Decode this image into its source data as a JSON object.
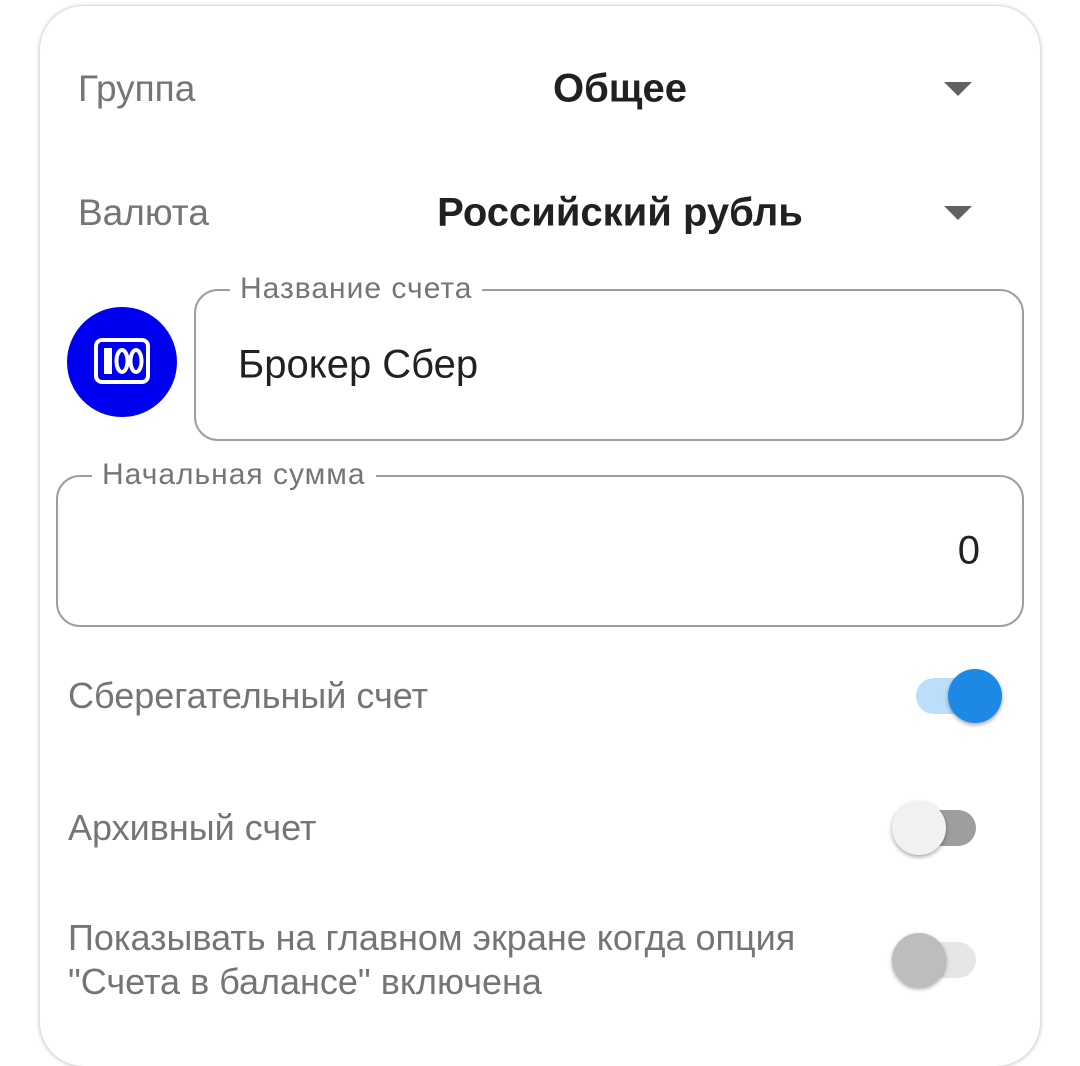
{
  "group": {
    "label": "Группа",
    "value": "Общее"
  },
  "currency": {
    "label": "Валюта",
    "value": "Российский рубль"
  },
  "account_icon": {
    "name": "cash-100-icon",
    "bg_color": "#0000f0",
    "glyph": "100"
  },
  "account_name": {
    "legend": "Название счета",
    "value": "Брокер Сбер"
  },
  "initial_amount": {
    "legend": "Начальная сумма",
    "value": "0"
  },
  "toggles": [
    {
      "label": "Сберегательный счет",
      "on": true
    },
    {
      "label": "Архивный счет",
      "on": false
    },
    {
      "label": "Показывать на главном экране когда опция \"Счета в балансе\" включена",
      "on": false
    }
  ],
  "colors": {
    "accent": "#1e88e5",
    "accent_track": "#bbdefb"
  }
}
